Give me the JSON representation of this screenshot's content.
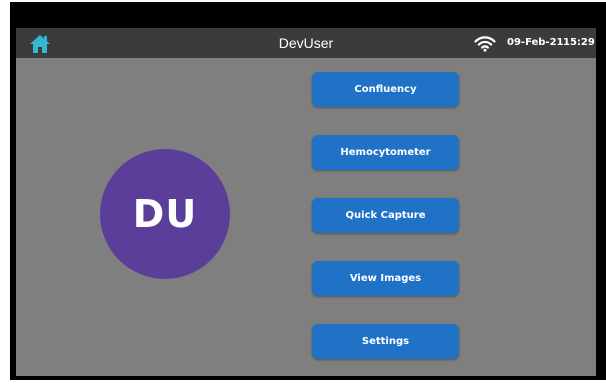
{
  "header": {
    "home_icon": "home-icon",
    "title": "DevUser",
    "wifi_icon": "wifi-icon",
    "date": "09-Feb-21",
    "time": "15:29"
  },
  "user": {
    "initials": "DU"
  },
  "menu": {
    "items": [
      {
        "label": "Confluency"
      },
      {
        "label": "Hemocytometer"
      },
      {
        "label": "Quick Capture"
      },
      {
        "label": "View Images"
      },
      {
        "label": "Settings"
      }
    ]
  },
  "colors": {
    "background": "#7f7f7f",
    "titlebar": "#3b3b3b",
    "button": "#1f72c5",
    "avatar": "#5b3d9a",
    "home_icon": "#35b7d2"
  }
}
